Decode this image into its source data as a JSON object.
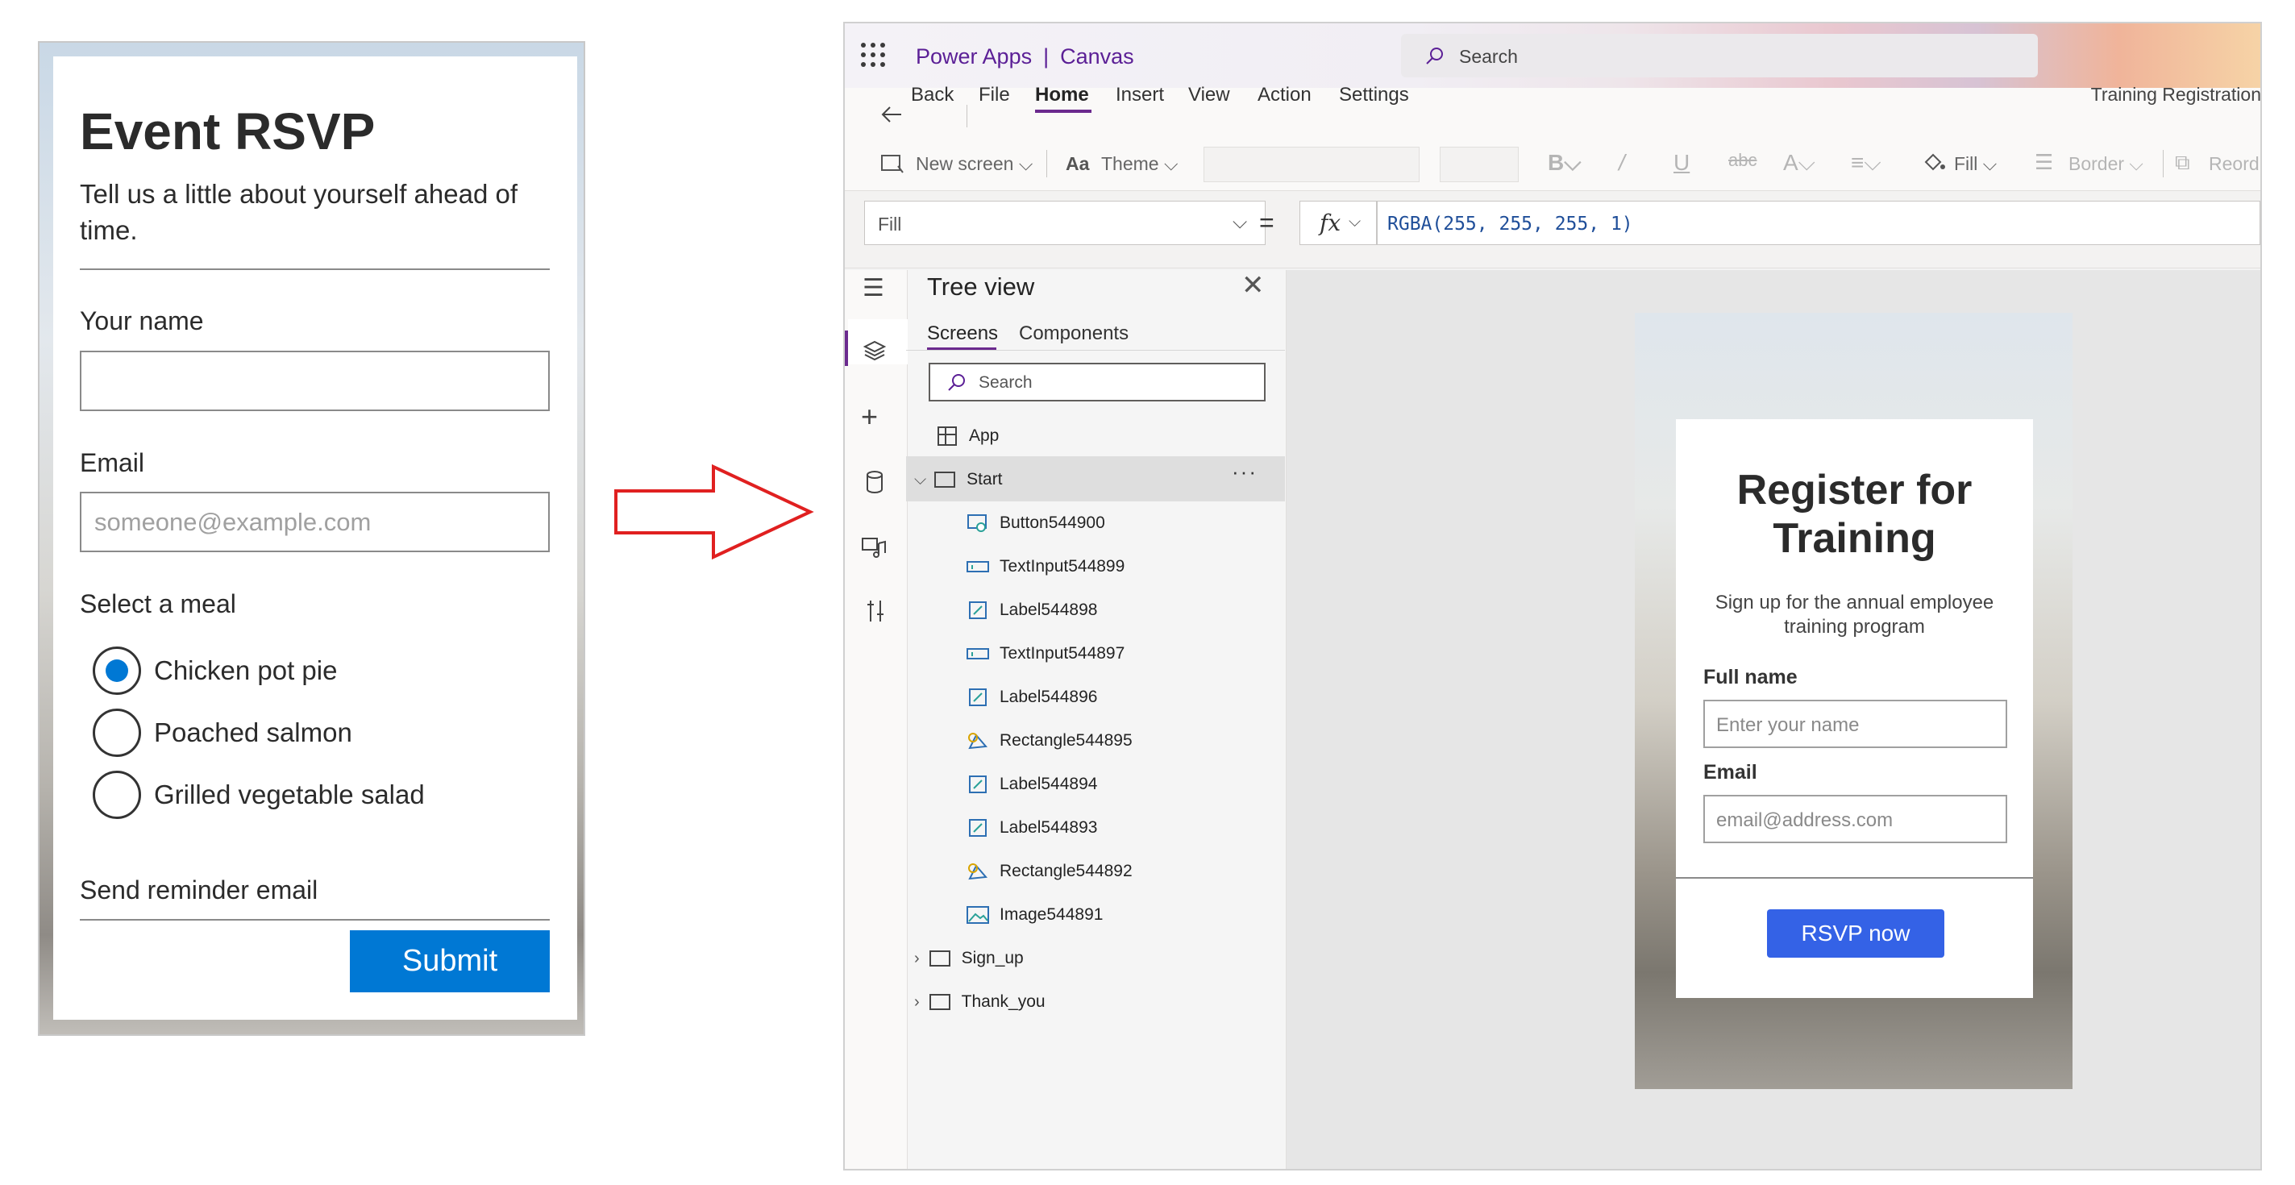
{
  "rsvp_form": {
    "title": "Event RSVP",
    "subtitle": "Tell us a little about yourself ahead of time.",
    "name_label": "Your name",
    "name_value": "",
    "email_label": "Email",
    "email_placeholder": "someone@example.com",
    "meal_label": "Select a meal",
    "meals": [
      "Chicken pot pie",
      "Poached salmon",
      "Grilled vegetable salad"
    ],
    "selected_meal": "Chicken pot pie",
    "reminder_label": "Send reminder email",
    "submit_label": "Submit"
  },
  "powerapps": {
    "brand": "Power Apps",
    "separator": "|",
    "mode": "Canvas",
    "search_placeholder": "Search",
    "menu": {
      "back": "Back",
      "file": "File",
      "home": "Home",
      "insert": "Insert",
      "view": "View",
      "action": "Action",
      "settings": "Settings"
    },
    "document_title": "Training Registration",
    "toolbar": {
      "new_screen": "New screen",
      "theme": "Theme",
      "fill": "Fill",
      "border": "Border",
      "reorder": "Reord"
    },
    "formula": {
      "property": "Fill",
      "equals": "=",
      "fx": "fx",
      "value": "RGBA(255, 255, 255, 1)"
    },
    "tree_view": {
      "title": "Tree view",
      "tabs": [
        "Screens",
        "Components"
      ],
      "search_placeholder": "Search",
      "app_node": "App",
      "screens": [
        {
          "name": "Start",
          "expanded": true,
          "children": [
            {
              "name": "Button544900",
              "icon": "button-icon"
            },
            {
              "name": "TextInput544899",
              "icon": "text-input-icon"
            },
            {
              "name": "Label544898",
              "icon": "label-icon"
            },
            {
              "name": "TextInput544897",
              "icon": "text-input-icon"
            },
            {
              "name": "Label544896",
              "icon": "label-icon"
            },
            {
              "name": "Rectangle544895",
              "icon": "rectangle-icon"
            },
            {
              "name": "Label544894",
              "icon": "label-icon"
            },
            {
              "name": "Label544893",
              "icon": "label-icon"
            },
            {
              "name": "Rectangle544892",
              "icon": "rectangle-icon"
            },
            {
              "name": "Image544891",
              "icon": "image-icon"
            }
          ]
        },
        {
          "name": "Sign_up",
          "expanded": false
        },
        {
          "name": "Thank_you",
          "expanded": false
        }
      ]
    },
    "app_preview": {
      "title": "Register for Training",
      "subtitle": "Sign up for the annual employee training program",
      "full_name_label": "Full name",
      "full_name_placeholder": "Enter your name",
      "email_label": "Email",
      "email_placeholder": "email@address.com",
      "button_label": "RSVP now"
    }
  },
  "colors": {
    "primary_blue": "#0078d4",
    "powerapps_purple": "#6b2a8e",
    "rsvp_button_blue": "#3462e6",
    "arrow_red": "#e02020"
  }
}
